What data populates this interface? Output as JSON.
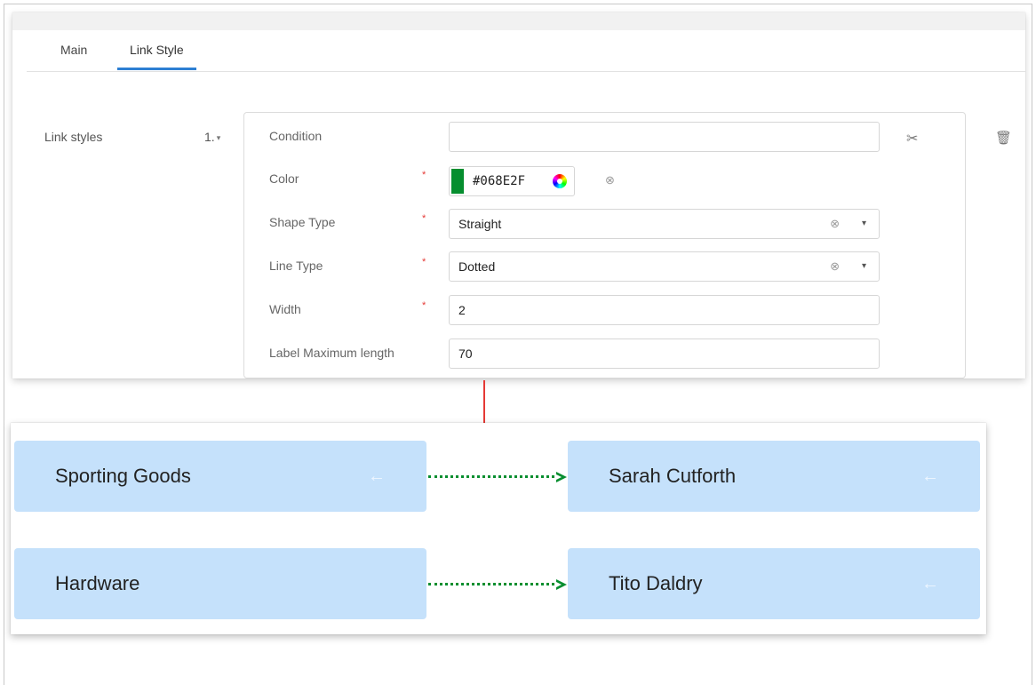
{
  "tabs": {
    "main": "Main",
    "link_style": "Link Style"
  },
  "link_styles": {
    "label": "Link styles",
    "index": "1.",
    "fields": {
      "condition": {
        "label": "Condition",
        "value": ""
      },
      "color": {
        "label": "Color",
        "value": "#068E2F",
        "required": "*"
      },
      "shape_type": {
        "label": "Shape Type",
        "value": "Straight",
        "required": "*"
      },
      "line_type": {
        "label": "Line Type",
        "value": "Dotted",
        "required": "*"
      },
      "width": {
        "label": "Width",
        "value": "2",
        "required": "*"
      },
      "label_max_length": {
        "label": "Label Maximum length",
        "value": "70"
      }
    }
  },
  "icons": {
    "index_caret": "▾",
    "clear": "⊗",
    "dropdown": "▾",
    "condition_builder": "✂",
    "delete": "🗑",
    "node_arrow": "←"
  },
  "diagram": {
    "nodes": [
      {
        "left": "Sporting Goods",
        "right": "Sarah Cutforth"
      },
      {
        "left": "Hardware",
        "right": "Tito Daldry"
      }
    ]
  },
  "colors": {
    "accent": "#2d7fd3",
    "link": "#068E2F",
    "required": "#e53935",
    "node_bg": "#c5e1fb"
  }
}
